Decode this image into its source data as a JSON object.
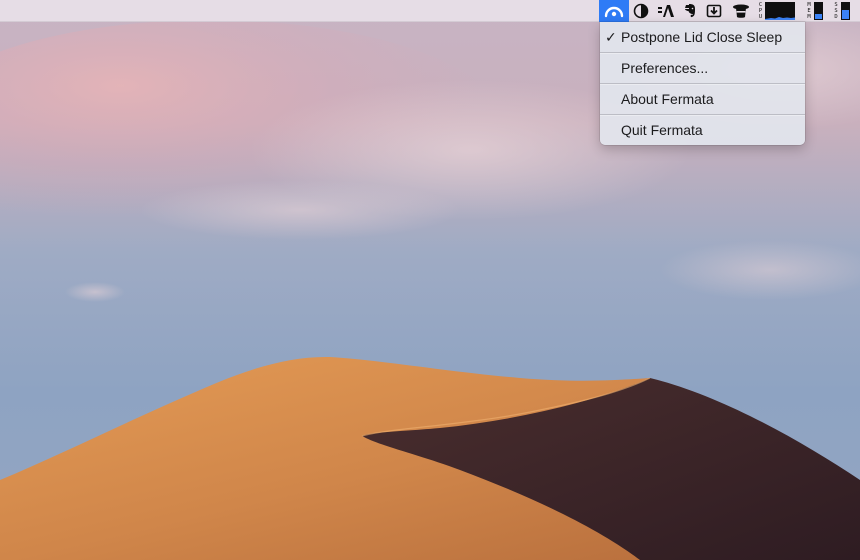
{
  "menubar": {
    "status_items": [
      {
        "name": "fermata-icon",
        "active": true
      },
      {
        "name": "contrast-icon"
      },
      {
        "name": "text-tool-icon"
      },
      {
        "name": "evernote-elephant-icon"
      },
      {
        "name": "download-tray-icon"
      },
      {
        "name": "top-hat-icon"
      },
      {
        "name": "cpu-monitor-icon"
      },
      {
        "name": "memory-monitor-icon"
      },
      {
        "name": "ssd-monitor-icon"
      }
    ],
    "cpu_label": [
      "C",
      "P",
      "U"
    ],
    "mem_label": [
      "M",
      "E",
      "M"
    ],
    "ssd_label": [
      "S",
      "S",
      "D"
    ],
    "mem_level": 0.3,
    "ssd_level": 0.55,
    "accent_color": "#2e7bf6"
  },
  "menu": {
    "items": [
      {
        "label": "Postpone Lid Close Sleep",
        "checked": true,
        "check_glyph": "✓"
      },
      {
        "label": "Preferences..."
      },
      {
        "label": "About Fermata"
      },
      {
        "label": "Quit Fermata"
      }
    ]
  }
}
